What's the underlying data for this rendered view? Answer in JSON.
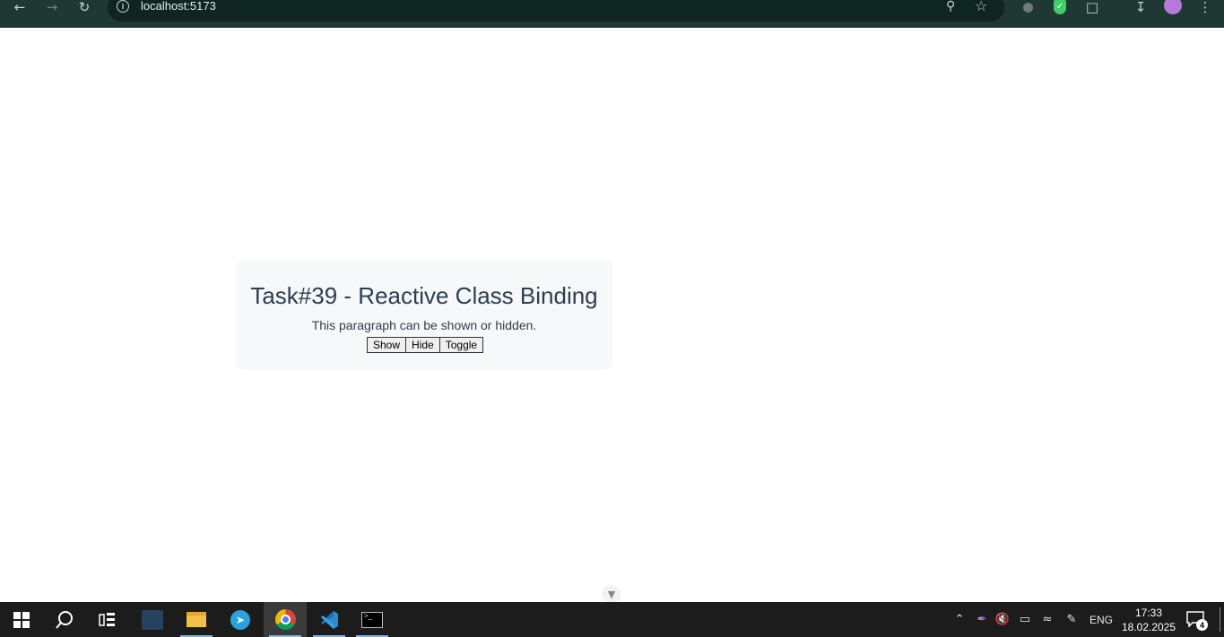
{
  "browser": {
    "url": "localhost:5173"
  },
  "page": {
    "title": "Task#39 - Reactive Class Binding",
    "paragraph": "This paragraph can be shown or hidden.",
    "buttons": {
      "show": "Show",
      "hide": "Hide",
      "toggle": "Toggle"
    }
  },
  "taskbar": {
    "language": "ENG",
    "time": "17:33",
    "date": "18.02.2025",
    "notification_count": "4"
  },
  "colors": {
    "browser_bar": "#1f3833",
    "card_background": "#f7f8fa",
    "title_text": "#2c3e50",
    "taskbar": "#1c1c1c"
  }
}
